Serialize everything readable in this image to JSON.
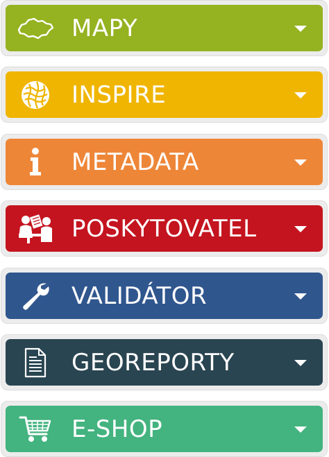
{
  "menu": {
    "items": [
      {
        "label": "MAPY",
        "icon": "czech-map-icon",
        "color": "#95b220"
      },
      {
        "label": "INSPIRE",
        "icon": "inspire-globe-icon",
        "color": "#efb500"
      },
      {
        "label": "METADATA",
        "icon": "info-icon",
        "color": "#ee8638"
      },
      {
        "label": "POSKYTOVATEL",
        "icon": "provider-icon",
        "color": "#c4141f"
      },
      {
        "label": "VALIDÁTOR",
        "icon": "wrench-icon",
        "color": "#30568e"
      },
      {
        "label": "GEOREPORTY",
        "icon": "document-icon",
        "color": "#294551"
      },
      {
        "label": "E-SHOP",
        "icon": "shopping-cart-icon",
        "color": "#43b37f"
      }
    ]
  }
}
